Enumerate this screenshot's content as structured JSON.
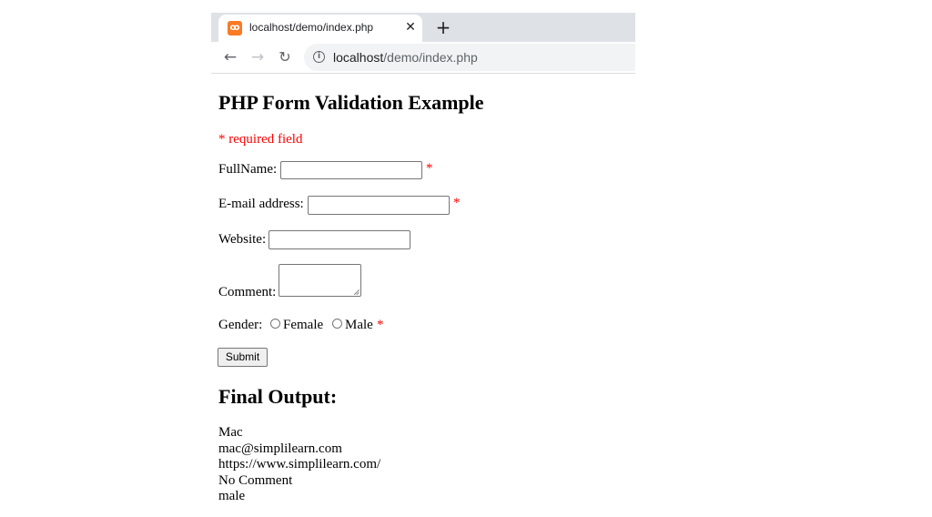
{
  "browser": {
    "tab_title": "localhost/demo/index.php",
    "tab_close": "✕",
    "new_tab": "+",
    "url_host": "localhost",
    "url_path": "/demo/index.php"
  },
  "form": {
    "title": "PHP Form Validation Example",
    "required_note": "* required field",
    "required_mark": "*",
    "fullname_label": "FullName:",
    "fullname_value": "",
    "email_label": "E-mail address:",
    "email_value": "",
    "website_label": "Website:",
    "website_value": "",
    "comment_label": "Comment:",
    "gender_label": "Gender:",
    "gender_options": [
      "Female",
      "Male"
    ],
    "submit_label": "Submit"
  },
  "output": {
    "title": "Final Output:",
    "lines": [
      "Mac",
      "mac@simplilearn.com",
      "https://www.simplilearn.com/",
      "No Comment",
      "male"
    ]
  }
}
